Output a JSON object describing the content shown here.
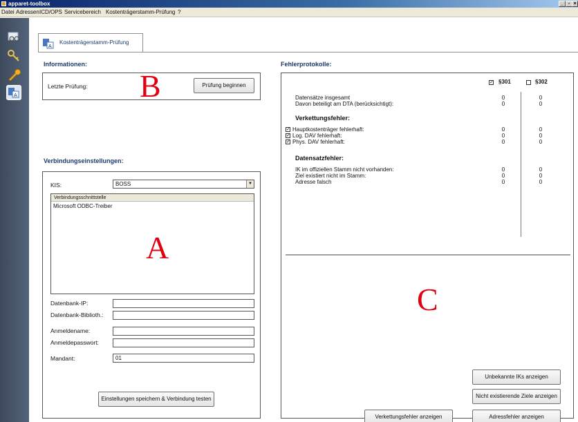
{
  "window": {
    "title": "apparet-toolbox",
    "controls": {
      "minimize": "_",
      "maximize": "▫",
      "close": "×"
    }
  },
  "menu": {
    "items": [
      "Datei",
      "Adressen",
      "ICD/OPS",
      "Servicebereich",
      "Kostenträgerstamm-Prüfung",
      "?"
    ]
  },
  "sidebar": {
    "icons": [
      "glasses-icon",
      "key-icon",
      "wrench-icon",
      "insurance-check-icon"
    ]
  },
  "tab": {
    "label": "Kostenträgerstamm-Prüfung"
  },
  "informationen": {
    "title": "Informationen:",
    "last_check_label": "Letzte Prüfung:",
    "start_button": "Prüfung beginnen",
    "marker": "B"
  },
  "verbindung": {
    "title": "Verbindungseinstellungen:",
    "kis_label": "KIS:",
    "kis_value": "BOSS",
    "list_header": "Verbindungsschnittstelle",
    "list_items": [
      "Microsoft ODBC-Treiber"
    ],
    "marker": "A",
    "fields": {
      "db_ip": {
        "label": "Datenbank-IP:",
        "value": ""
      },
      "db_lib": {
        "label": "Datenbank-Biblioth.:",
        "value": ""
      },
      "login": {
        "label": "Anmeldename:",
        "value": ""
      },
      "password": {
        "label": "Anmeldepasswort:",
        "value": ""
      },
      "mandant": {
        "label": "Mandant:",
        "value": "01"
      }
    },
    "save_button": "Einstellungen speichern & Verbindung testen"
  },
  "fehler": {
    "title": "Fehlerprotokolle:",
    "col_301": "§301",
    "col_302": "§302",
    "col_301_checked": true,
    "col_302_checked": false,
    "summary": [
      {
        "label": "Datensätze insgesamt",
        "v301": "0",
        "v302": "0"
      },
      {
        "label": "Davon beteiligt am DTA (berücksichtigt):",
        "v301": "0",
        "v302": "0"
      }
    ],
    "verkettung_title": "Verkettungsfehler:",
    "verkettung": [
      {
        "label": "Hauptkostenträger fehlerhaft:",
        "checked": true,
        "v301": "0",
        "v302": "0"
      },
      {
        "label": "Log. DAV fehlerhaft:",
        "checked": true,
        "v301": "0",
        "v302": "0"
      },
      {
        "label": "Phys. DAV fehlerhaft:",
        "checked": true,
        "v301": "0",
        "v302": "0"
      }
    ],
    "datensatz_title": "Datensatzfehler:",
    "datensatz": [
      {
        "label": "IK im offiziellen Stamm nicht vorhanden:",
        "v301": "0",
        "v302": "0"
      },
      {
        "label": "Ziel existiert nicht im Stamm:",
        "v301": "0",
        "v302": "0"
      },
      {
        "label": "Adresse falsch",
        "v301": "0",
        "v302": "0"
      }
    ],
    "marker": "C",
    "buttons": {
      "unknown_iks": "Unbekannte IKs anzeigen",
      "missing_targets": "Nicht existierende Ziele anzeigen",
      "chain_errors": "Verkettungsfehler anzeigen",
      "address_errors": "Adressfehler anzeigen"
    }
  }
}
